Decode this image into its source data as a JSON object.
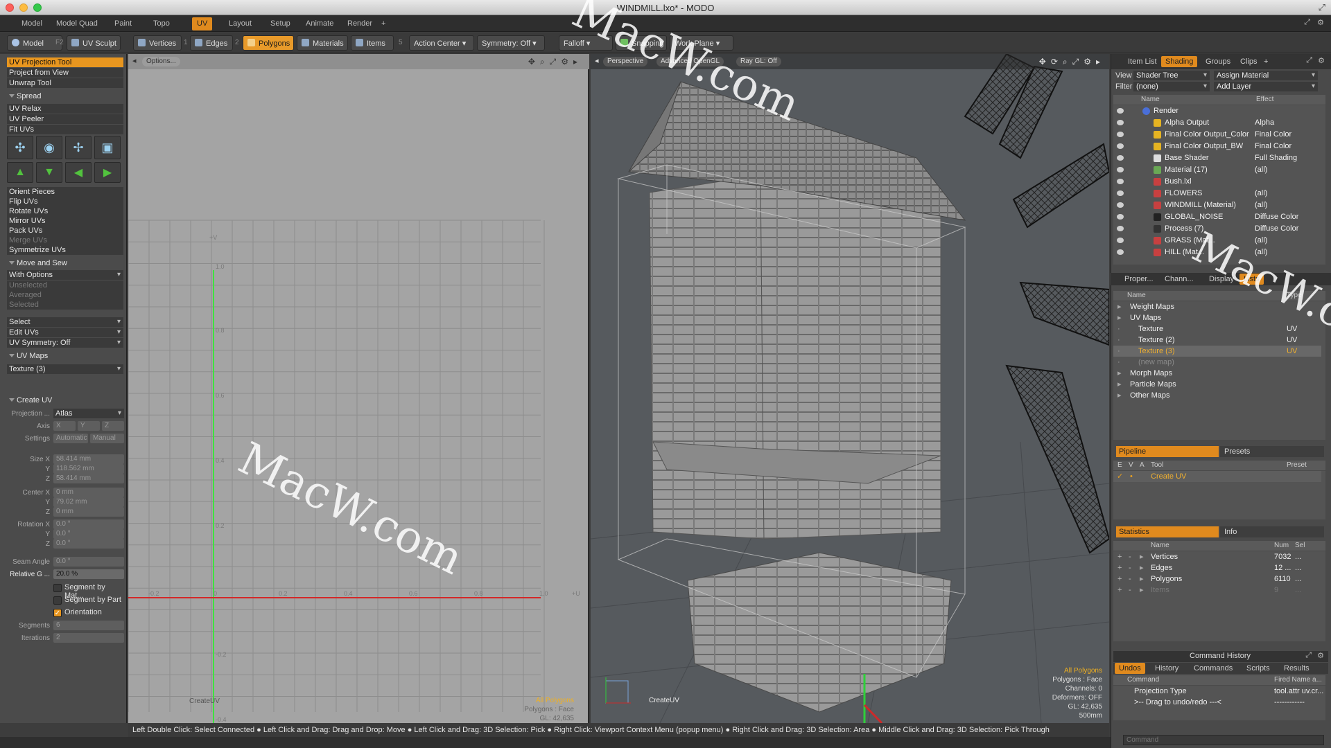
{
  "window": {
    "title": "WINDMILL.lxo* - MODO"
  },
  "tabs": [
    "Model",
    "Model Quad",
    "Paint",
    "Topo",
    "UV",
    "Layout",
    "Setup",
    "Animate",
    "Render",
    "+"
  ],
  "active_tab": "UV",
  "toolbar": {
    "model": "Model",
    "model_key": "F2",
    "uv_sculpt": "UV Sculpt",
    "vertices": "Vertices",
    "vertices_key": "1",
    "edges": "Edges",
    "edges_key": "2",
    "polygons": "Polygons",
    "materials": "Materials",
    "items": "Items",
    "items_key": "5",
    "action_center": "Action Center",
    "symmetry": "Symmetry: Off",
    "falloff": "Falloff",
    "snapping": "Snapping",
    "work_plane": "Work Plane"
  },
  "left_panel": {
    "tools": [
      "UV Projection Tool",
      "Project from View",
      "Unwrap Tool"
    ],
    "spread": "Spread",
    "relax_tools": [
      "UV Relax",
      "UV Peeler",
      "Fit UVs"
    ],
    "tool_icons": [
      "uv-transform-icon",
      "uv-rotate-icon",
      "uv-scale-icon",
      "uv-cube-icon"
    ],
    "arrow_icons": [
      "up-arrow-icon",
      "down-arrow-icon",
      "left-arrow-icon",
      "right-arrow-icon"
    ],
    "ops": [
      "Orient Pieces",
      "Flip UVs",
      "Rotate UVs",
      "Mirror UVs",
      "Pack UVs",
      "Merge UVs",
      "Symmetrize UVs"
    ],
    "move_sew": "Move and Sew",
    "with_options": "With Options",
    "sew_opts": [
      "Unselected",
      "Averaged",
      "Selected"
    ],
    "select": "Select",
    "edit_uvs": "Edit UVs",
    "uv_symmetry": "UV Symmetry: Off",
    "uv_maps": "UV Maps",
    "texture_sel": "Texture (3)",
    "create_uv": "Create UV",
    "projection_label": "Projection ...",
    "projection_value": "Atlas",
    "axis_label": "Axis",
    "axis_vals": [
      "X",
      "Y",
      "Z"
    ],
    "settings_label": "Settings",
    "settings_vals": [
      "Automatic",
      "Manual"
    ],
    "size_label": "Size X",
    "size_y": "Y",
    "size_z": "Z",
    "size": [
      "58.414 mm",
      "118.562 mm",
      "58.414 mm"
    ],
    "center_label": "Center X",
    "center": [
      "0 mm",
      "79.02 mm",
      "0 mm"
    ],
    "rotation_label": "Rotation X",
    "rotation": [
      "0.0 °",
      "0.0 °",
      "0.0 °"
    ],
    "seam_label": "Seam Angle",
    "seam": "0.0 °",
    "relg_label": "Relative G ...",
    "relg": "20.0 %",
    "checks": [
      {
        "label": "Segment by Mat...",
        "on": false
      },
      {
        "label": "Segment by Part",
        "on": false
      },
      {
        "label": "Orientation",
        "on": true
      }
    ],
    "segments_label": "Segments",
    "segments": "6",
    "iterations_label": "Iterations",
    "iterations": "2"
  },
  "uv_viewport": {
    "options": "Options...",
    "x_ticks": [
      "-0.2",
      "0",
      "0.2",
      "0.4",
      "0.6",
      "0.8",
      "1.0",
      "+U"
    ],
    "y_ticks": [
      "+V",
      "1.0",
      "0.8",
      "0.6",
      "0.4",
      "0.2",
      "-0.2",
      "-0.4"
    ],
    "label": "CreateUV",
    "stats": [
      "All Polygons",
      "Polygons : Face",
      "GL: 42,635"
    ]
  },
  "persp_viewport": {
    "buttons": [
      "Perspective",
      "Advanced OpenGL",
      "Ray GL: Off"
    ],
    "label": "CreateUV",
    "stats": [
      "All Polygons",
      "Polygons : Face",
      "Channels: 0",
      "Deformers: OFF",
      "GL: 42,635",
      "500mm"
    ]
  },
  "status_bar": "Left Double Click: Select Connected ● Left Click and Drag: Drag and Drop: Move ● Left Click and Drag: 3D Selection: Pick ● Right Click: Viewport Context Menu (popup menu) ● Right Click and Drag: 3D Selection: Area ● Middle Click and Drag: 3D Selection: Pick Through",
  "right_panel": {
    "tabs": [
      "Item List",
      "Shading",
      "Groups",
      "Clips",
      "+"
    ],
    "view_label": "View",
    "view_value": "Shader Tree",
    "assign_material": "Assign Material",
    "filter_label": "Filter",
    "filter_value": "(none)",
    "add_layer": "Add Layer",
    "shader_cols": [
      "Name",
      "Effect"
    ],
    "shader_rows": [
      {
        "name": "Render",
        "effect": "",
        "icon": "#4a6fd8",
        "indent": 0
      },
      {
        "name": "Alpha Output",
        "effect": "Alpha",
        "icon": "#e6b422",
        "indent": 1
      },
      {
        "name": "Final Color Output_Color",
        "effect": "Final Color",
        "icon": "#e6b422",
        "indent": 1
      },
      {
        "name": "Final Color Output_BW",
        "effect": "Final Color",
        "icon": "#e6b422",
        "indent": 1
      },
      {
        "name": "Base Shader",
        "effect": "Full Shading",
        "icon": "#dddddd",
        "indent": 1
      },
      {
        "name": "Material (17)",
        "effect": "(all)",
        "icon": "#6aa855",
        "indent": 1
      },
      {
        "name": "Bush.lxl",
        "effect": "",
        "icon": "#c84040",
        "indent": 1
      },
      {
        "name": "FLOWERS",
        "effect": "(all)",
        "icon": "#c84040",
        "indent": 1
      },
      {
        "name": "WINDMILL (Material)",
        "effect": "(all)",
        "icon": "#c84040",
        "indent": 1
      },
      {
        "name": "GLOBAL_NOISE",
        "effect": "Diffuse Color",
        "icon": "#222222",
        "indent": 1
      },
      {
        "name": "Process (7)",
        "effect": "Diffuse Color",
        "icon": "#333333",
        "indent": 1
      },
      {
        "name": "GRASS (Mat...",
        "effect": "(all)",
        "icon": "#c84040",
        "indent": 1
      },
      {
        "name": "HILL (Mat...",
        "effect": "(all)",
        "icon": "#c84040",
        "indent": 1
      }
    ],
    "props_tabs": [
      "Proper...",
      "Chann...",
      "Display",
      "Lists"
    ],
    "list_cols": [
      "Name",
      "Type"
    ],
    "list_rows": [
      {
        "name": "Weight Maps",
        "type": "",
        "indent": 0,
        "sel": false
      },
      {
        "name": "UV Maps",
        "type": "",
        "indent": 0,
        "sel": false
      },
      {
        "name": "Texture",
        "type": "UV",
        "indent": 1,
        "sel": false
      },
      {
        "name": "Texture (2)",
        "type": "UV",
        "indent": 1,
        "sel": false
      },
      {
        "name": "Texture (3)",
        "type": "UV",
        "indent": 1,
        "sel": true
      },
      {
        "name": "(new map)",
        "type": "",
        "indent": 1,
        "sel": false
      },
      {
        "name": "Morph Maps",
        "type": "",
        "indent": 0,
        "sel": false
      },
      {
        "name": "Particle Maps",
        "type": "",
        "indent": 0,
        "sel": false
      },
      {
        "name": "Other Maps",
        "type": "",
        "indent": 0,
        "sel": false
      }
    ],
    "pipeline": "Pipeline",
    "presets": "Presets",
    "pipe_cols": [
      "E",
      "V",
      "A",
      "Tool",
      "Preset"
    ],
    "pipe_row": "Create UV",
    "statistics": "Statistics",
    "info": "Info",
    "stat_cols": [
      "Name",
      "Num",
      "Sel"
    ],
    "stat_rows": [
      {
        "name": "Vertices",
        "num": "7032",
        "sel": "..."
      },
      {
        "name": "Edges",
        "num": "12 ...",
        "sel": "..."
      },
      {
        "name": "Polygons",
        "num": "6110",
        "sel": "..."
      },
      {
        "name": "Items",
        "num": "9",
        "sel": "..."
      }
    ],
    "command_history": "Command History",
    "ch_tabs": [
      "Undos",
      "History",
      "Commands",
      "Scripts",
      "Results"
    ],
    "ch_cols": [
      "Command",
      "Fired Name a..."
    ],
    "ch_rows": [
      {
        "cmd": "Projection Type",
        "fired": "tool.attr uv.cr..."
      },
      {
        "cmd": ">-- Drag to undo/redo ---<",
        "fired": "------------"
      }
    ],
    "command_placeholder": "Command"
  },
  "watermark": "MacW.com"
}
